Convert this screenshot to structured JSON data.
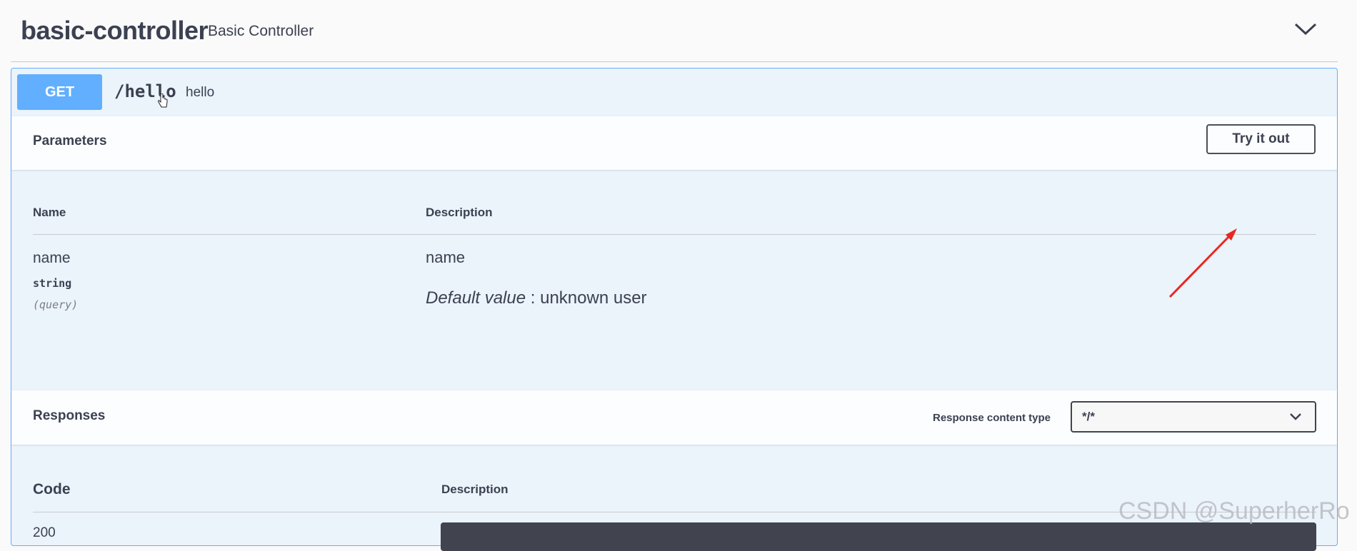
{
  "tag": {
    "name": "basic-controller",
    "description": "Basic Controller",
    "chevron_icon": "chevron-down-icon"
  },
  "operation": {
    "method": "GET",
    "path": "/hello",
    "summary": "hello",
    "method_color": "#61affe"
  },
  "parameters": {
    "title": "Parameters",
    "try_button": "Try it out",
    "columns": {
      "name": "Name",
      "description": "Description"
    },
    "items": [
      {
        "name": "name",
        "type": "string",
        "in": "(query)",
        "description": "name",
        "default_label": "Default value",
        "default_sep": " : ",
        "default_value": "unknown user"
      }
    ]
  },
  "responses": {
    "title": "Responses",
    "content_type_label": "Response content type",
    "content_type_value": "*/*",
    "columns": {
      "code": "Code",
      "description": "Description"
    },
    "rows": [
      {
        "code": "200"
      }
    ]
  },
  "watermark": "CSDN @SuperherRo"
}
